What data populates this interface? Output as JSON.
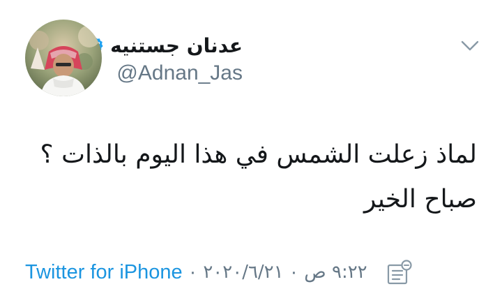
{
  "tweet": {
    "author": {
      "display_name": "عدنان جستنيه",
      "handle": "@Adnan_Jas",
      "verified_icon": "verified-badge-icon",
      "avatar": "author-avatar"
    },
    "text_lines": [
      "لماذ زعلت الشمس في هذا اليوم بالذات ؟",
      "صباح الخير"
    ],
    "meta": {
      "source": "Twitter for iPhone",
      "separator": "·",
      "date": "٢٠٢٠/٦/٢١",
      "time": "٩:٢٢ ص",
      "analytics_icon": "tweet-analytics-icon"
    },
    "menu_icon": "chevron-down-icon"
  },
  "colors": {
    "text": "#14171a",
    "secondary": "#657786",
    "link": "#1b95e0",
    "verified": "#1da1f2"
  }
}
